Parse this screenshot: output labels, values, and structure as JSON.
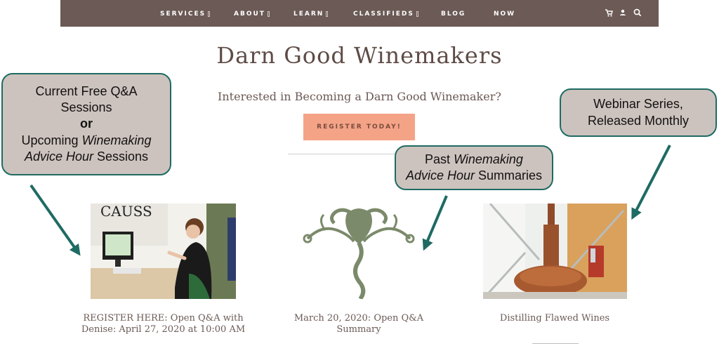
{
  "nav": {
    "items": [
      {
        "label": "SERVICES",
        "has_menu": true
      },
      {
        "label": "ABOUT",
        "has_menu": true
      },
      {
        "label": "LEARN",
        "has_menu": true
      },
      {
        "label": "CLASSIFIEDS",
        "has_menu": true
      },
      {
        "label": "BLOG",
        "has_menu": false
      },
      {
        "label": "NOW",
        "has_menu": false
      }
    ],
    "icons": [
      "cart-icon",
      "user-icon",
      "search-icon"
    ],
    "bg_color": "#6b5a55"
  },
  "header": {
    "title": "Darn Good Winemakers",
    "tagline": "Interested in Becoming a Darn Good Winemaker?",
    "register_label": "REGISTER TODAY!",
    "register_color": "#f4a387"
  },
  "callouts": {
    "left": {
      "line1": "Current Free Q&A",
      "line2": "Sessions",
      "line3": "or",
      "line4_prefix": "Upcoming ",
      "line4_em": "Winemaking",
      "line5_em": "Advice Hour",
      "line5_suffix": " Sessions"
    },
    "mid": {
      "line1_prefix": "Past ",
      "line1_em": "Winemaking",
      "line2_em": "Advice Hour",
      "line2_suffix": " Summaries"
    },
    "right": {
      "line1": "Webinar Series,",
      "line2": "Released Monthly"
    },
    "border_color": "#1e6b63",
    "fill_color": "#cdc3be"
  },
  "cards": [
    {
      "caption": "REGISTER HERE: Open Q&A with Denise: April 27, 2020 at 10:00 AM"
    },
    {
      "caption": "March 20, 2020: Open Q&A Summary"
    },
    {
      "caption": "Distilling Flawed Wines"
    }
  ]
}
